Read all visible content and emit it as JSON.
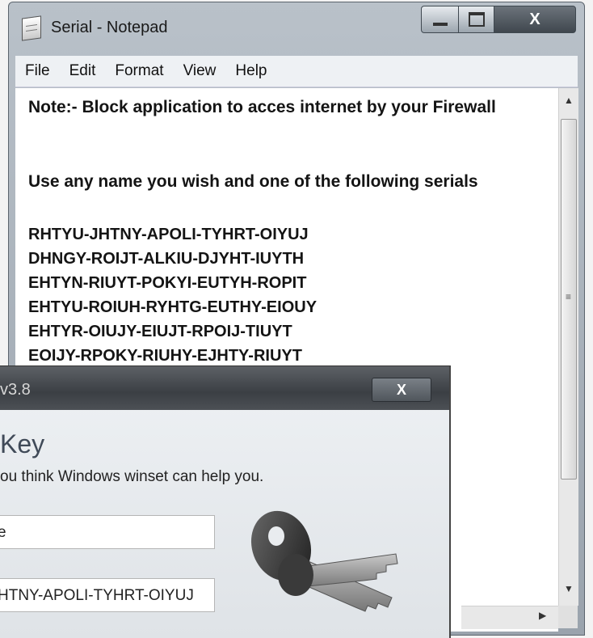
{
  "notepad": {
    "title": "Serial - Notepad",
    "menu": [
      "File",
      "Edit",
      "Format",
      "View",
      "Help"
    ],
    "close_glyph": "X",
    "lines": [
      "Note:- Block application to acces internet by your Firewall",
      "Use any name you wish and one of the following serials",
      "RHTYU-JHTNY-APOLI-TYHRT-OIYUJ",
      "DHNGY-ROIJT-ALKIU-DJYHT-IUYTH",
      "EHTYN-RIUYT-POKYI-EUTYH-ROPIT",
      "EHTYU-ROIUH-RYHTG-EUTHY-EIOUY",
      "EHTYR-OIUJY-EIUJT-RPOIJ-TIUYT",
      "EOIJY-RPOKY-RIUHY-EJHTY-RIUYT"
    ]
  },
  "dialog": {
    "title": "v3.8",
    "close_glyph": "X",
    "heading": "Key",
    "description": "ou think Windows winset can help you.",
    "name_value": "e",
    "serial_value": "HTNY-APOLI-TYHRT-OIYUJ"
  },
  "icons": [
    "notepad-icon",
    "minimize-icon",
    "maximize-icon",
    "close-icon",
    "keys-icon",
    "scroll-up-icon",
    "scroll-down-icon",
    "scroll-right-icon"
  ]
}
